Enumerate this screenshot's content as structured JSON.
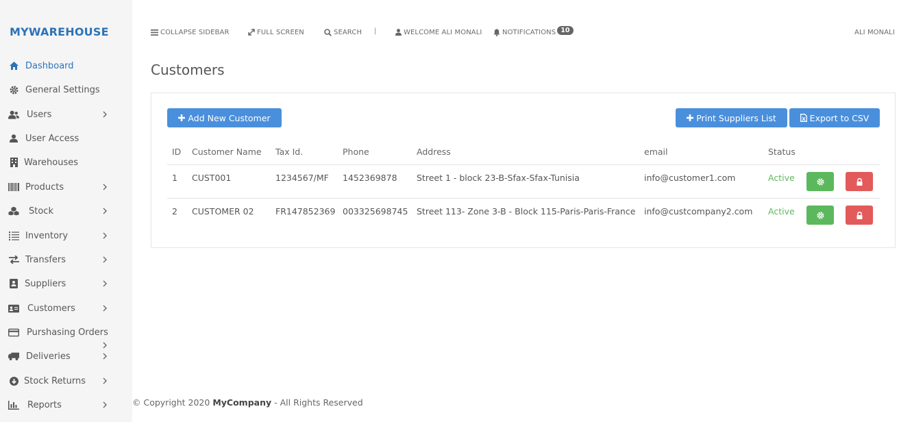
{
  "brand": "MYWAREHOUSE",
  "sidebar": {
    "items": [
      {
        "label": "Dashboard",
        "icon": "home-icon",
        "has_chevron": false,
        "active": true
      },
      {
        "label": "General Settings",
        "icon": "gear-icon",
        "has_chevron": false
      },
      {
        "label": "Users",
        "icon": "users-icon",
        "has_chevron": true
      },
      {
        "label": "User Access",
        "icon": "user-icon",
        "has_chevron": false
      },
      {
        "label": "Warehouses",
        "icon": "building-icon",
        "has_chevron": false
      },
      {
        "label": "Products",
        "icon": "barcode-icon",
        "has_chevron": true
      },
      {
        "label": "Stock",
        "icon": "cubes-icon",
        "has_chevron": true
      },
      {
        "label": "Inventory",
        "icon": "list-icon",
        "has_chevron": true
      },
      {
        "label": "Transfers",
        "icon": "exchange-icon",
        "has_chevron": true
      },
      {
        "label": "Suppliers",
        "icon": "address-book-icon",
        "has_chevron": true
      },
      {
        "label": "Customers",
        "icon": "id-card-icon",
        "has_chevron": true
      },
      {
        "label": "Purshasing Orders",
        "icon": "credit-card-icon",
        "has_chevron": false
      },
      {
        "label": "Deliveries",
        "icon": "truck-icon",
        "has_chevron": true
      },
      {
        "label": "Stock Returns",
        "icon": "arrow-circle-down-icon",
        "has_chevron": true
      },
      {
        "label": "Reports",
        "icon": "bar-chart-icon",
        "has_chevron": true
      }
    ]
  },
  "topbar": {
    "collapse": "COLLAPSE SIDEBAR",
    "fullscreen": "FULL SCREEN",
    "search": "SEARCH",
    "separator": "|",
    "welcome": "WELCOME ALI MONALI",
    "notifications": "NOTIFICATIONS",
    "notifications_count": "10",
    "user": "ALI MONALI"
  },
  "page": {
    "title": "Customers"
  },
  "actions": {
    "add": "Add New Customer",
    "print": "Print Suppliers List",
    "export": "Export to CSV"
  },
  "table": {
    "headers": [
      "ID",
      "Customer Name",
      "Tax Id.",
      "Phone",
      "Address",
      "email",
      "Status"
    ],
    "rows": [
      {
        "id": "1",
        "name": "CUST001",
        "tax": "1234567/MF",
        "phone": "1452369878",
        "address": "Street 1 - block 23-B-Sfax-Sfax-Tunisia",
        "email": "info@customer1.com",
        "status": "Active"
      },
      {
        "id": "2",
        "name": "CUSTOMER 02",
        "tax": "FR147852369",
        "phone": "003325698745",
        "address": "Street 113- Zone 3-B - Block 115-Paris-Paris-France",
        "email": "info@custcompany2.com",
        "status": "Active"
      }
    ]
  },
  "footer": {
    "prefix": "© Copyright 2020",
    "company": "MyCompany",
    "suffix": "- All Rights Reserved"
  },
  "colors": {
    "brand": "#2c73b8",
    "primary_button": "#4a8fdc",
    "success": "#5cb85c",
    "danger": "#e25a5a"
  }
}
